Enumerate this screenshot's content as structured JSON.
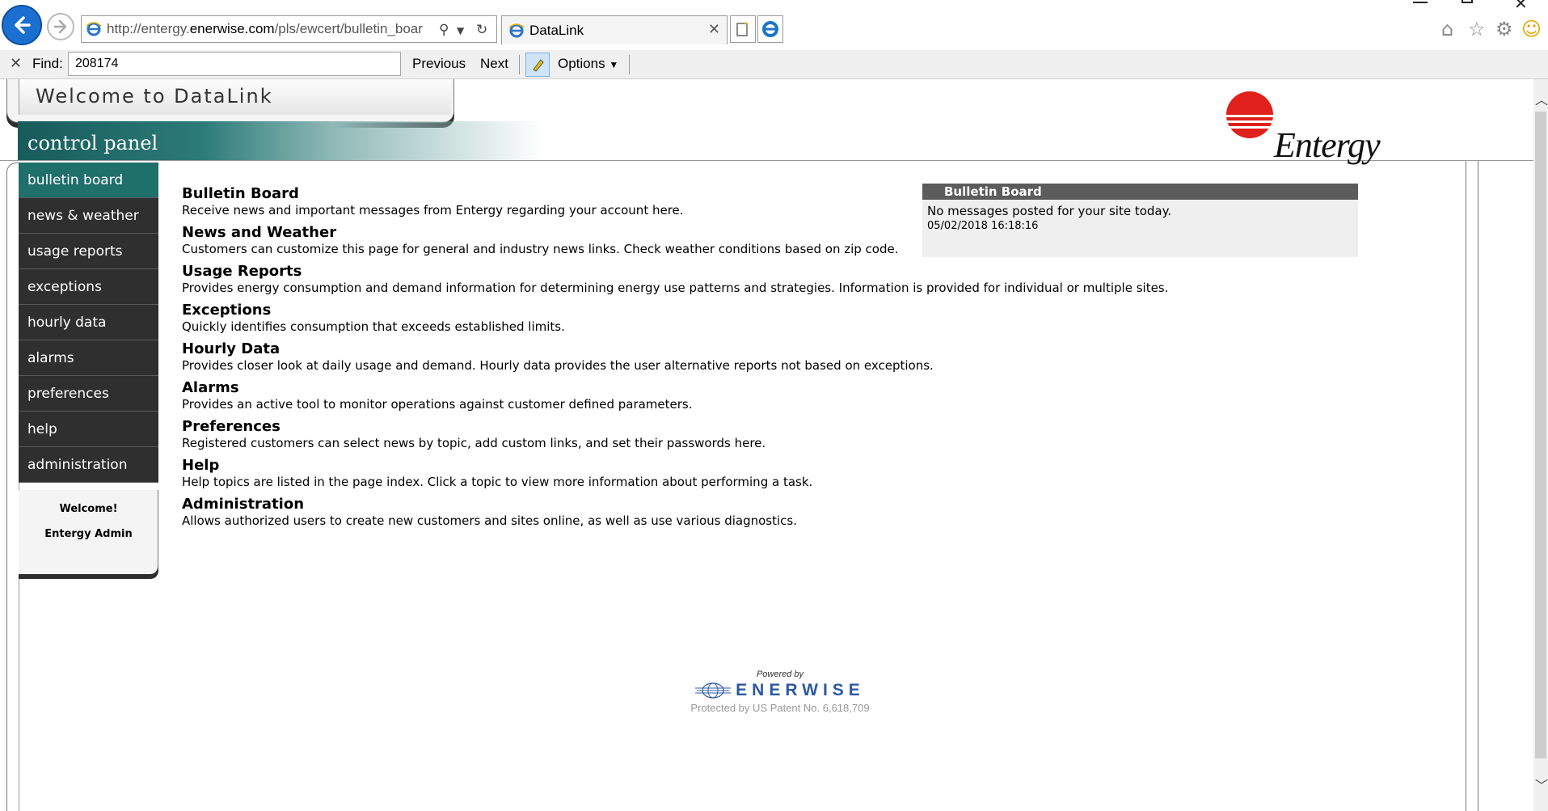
{
  "browser": {
    "url_prefix": "http://entergy.",
    "url_domain": "enerwise.com",
    "url_suffix": "/pls/ewcert/bulletin_boar",
    "tab_title": "DataLink",
    "tab_close": "✕"
  },
  "findbar": {
    "close": "✕",
    "label": "Find:",
    "query": "208174",
    "previous": "Previous",
    "next": "Next",
    "options": "Options"
  },
  "header": {
    "welcome": "Welcome to DataLink",
    "control_panel": "control panel",
    "logo_text": "Entergy"
  },
  "nav": {
    "items": [
      {
        "label": "bulletin board"
      },
      {
        "label": "news & weather"
      },
      {
        "label": "usage reports"
      },
      {
        "label": "exceptions"
      },
      {
        "label": "hourly data"
      },
      {
        "label": "alarms"
      },
      {
        "label": "preferences"
      },
      {
        "label": "help"
      },
      {
        "label": "administration"
      }
    ],
    "welcome_line": "Welcome!",
    "user_line": "Entergy Admin"
  },
  "sections": [
    {
      "title": "Bulletin Board",
      "desc": "Receive news and important messages from Entergy regarding your account here."
    },
    {
      "title": "News and Weather",
      "desc": "Customers can customize this page for general and industry news links. Check weather conditions based on zip code."
    },
    {
      "title": "Usage Reports",
      "desc": "Provides energy consumption and demand information for determining energy use patterns and strategies. Information is provided for individual or multiple sites."
    },
    {
      "title": "Exceptions",
      "desc": "Quickly identifies consumption that exceeds established limits."
    },
    {
      "title": "Hourly Data",
      "desc": "Provides closer look at daily usage and demand. Hourly data provides the user alternative reports not based on exceptions."
    },
    {
      "title": "Alarms",
      "desc": "Provides an active tool to monitor operations against customer defined parameters."
    },
    {
      "title": "Preferences",
      "desc": "Registered customers can select news by topic, add custom links, and set their passwords here."
    },
    {
      "title": "Help",
      "desc": "Help topics are listed in the page index. Click a topic to view more information about performing a task."
    },
    {
      "title": "Administration",
      "desc": "Allows authorized users to create new customers and sites online, as well as use various diagnostics."
    }
  ],
  "bulletin_panel": {
    "header": "Bulletin Board",
    "message": "No messages posted for your site today.",
    "timestamp": "05/02/2018 16:18:16"
  },
  "footer": {
    "powered_by": "Powered by",
    "brand": "ENERWISE",
    "patent": "Protected by US Patent No. 6,618,709"
  },
  "colors": {
    "nav_bg": "#2f2f2f",
    "nav_active": "#1f6f6b",
    "bulletin_header": "#5c5c5c",
    "brand_red": "#e0201b",
    "enerwise_blue": "#2c5aa0"
  },
  "icons": {
    "back": "back-arrow-icon",
    "forward": "forward-arrow-icon",
    "ie": "ie-page-icon",
    "search": "search-icon",
    "refresh": "refresh-icon",
    "home": "home-icon",
    "favorites": "star-icon",
    "settings": "gear-icon",
    "feedback": "smiley-icon"
  }
}
